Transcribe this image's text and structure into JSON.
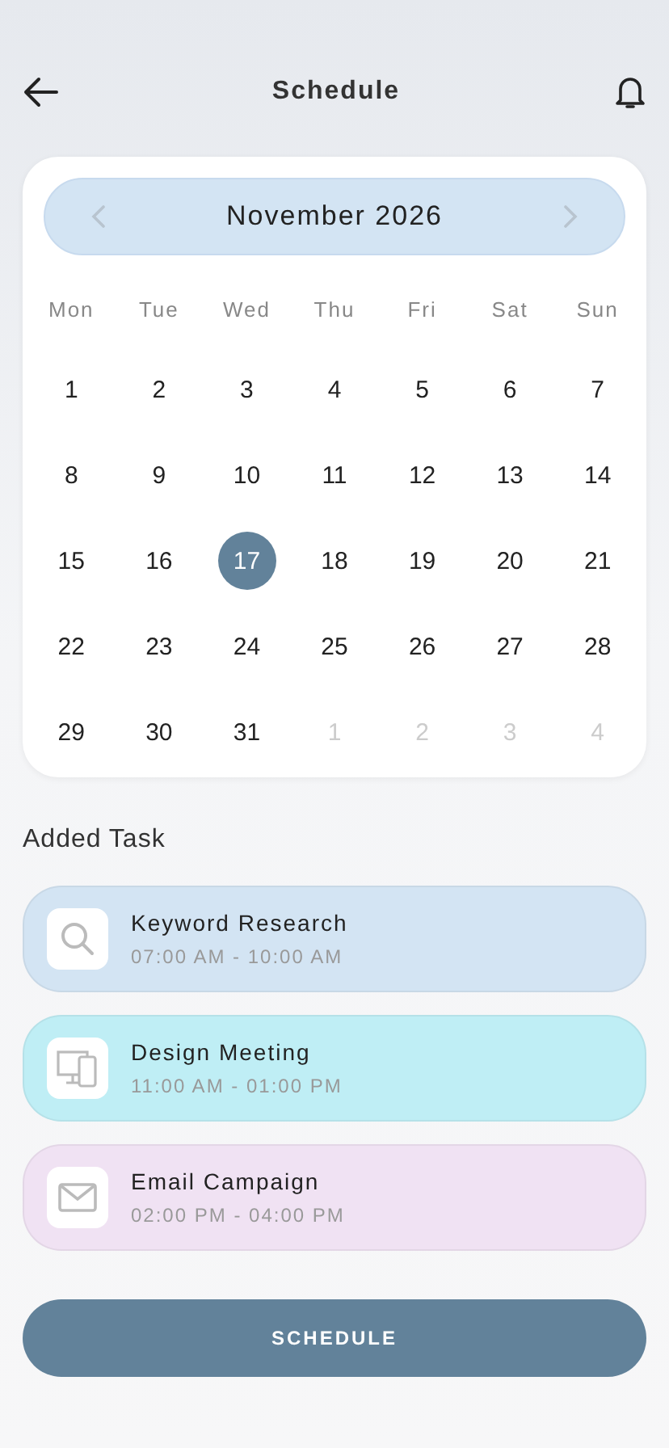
{
  "header": {
    "title": "Schedule"
  },
  "calendar": {
    "month": "November 2026",
    "weekdays": [
      "Mon",
      "Tue",
      "Wed",
      "Thu",
      "Fri",
      "Sat",
      "Sun"
    ],
    "days": [
      {
        "label": "1",
        "selected": false,
        "outside": false
      },
      {
        "label": "2",
        "selected": false,
        "outside": false
      },
      {
        "label": "3",
        "selected": false,
        "outside": false
      },
      {
        "label": "4",
        "selected": false,
        "outside": false
      },
      {
        "label": "5",
        "selected": false,
        "outside": false
      },
      {
        "label": "6",
        "selected": false,
        "outside": false
      },
      {
        "label": "7",
        "selected": false,
        "outside": false
      },
      {
        "label": "8",
        "selected": false,
        "outside": false
      },
      {
        "label": "9",
        "selected": false,
        "outside": false
      },
      {
        "label": "10",
        "selected": false,
        "outside": false
      },
      {
        "label": "11",
        "selected": false,
        "outside": false
      },
      {
        "label": "12",
        "selected": false,
        "outside": false
      },
      {
        "label": "13",
        "selected": false,
        "outside": false
      },
      {
        "label": "14",
        "selected": false,
        "outside": false
      },
      {
        "label": "15",
        "selected": false,
        "outside": false
      },
      {
        "label": "16",
        "selected": false,
        "outside": false
      },
      {
        "label": "17",
        "selected": true,
        "outside": false
      },
      {
        "label": "18",
        "selected": false,
        "outside": false
      },
      {
        "label": "19",
        "selected": false,
        "outside": false
      },
      {
        "label": "20",
        "selected": false,
        "outside": false
      },
      {
        "label": "21",
        "selected": false,
        "outside": false
      },
      {
        "label": "22",
        "selected": false,
        "outside": false
      },
      {
        "label": "23",
        "selected": false,
        "outside": false
      },
      {
        "label": "24",
        "selected": false,
        "outside": false
      },
      {
        "label": "25",
        "selected": false,
        "outside": false
      },
      {
        "label": "26",
        "selected": false,
        "outside": false
      },
      {
        "label": "27",
        "selected": false,
        "outside": false
      },
      {
        "label": "28",
        "selected": false,
        "outside": false
      },
      {
        "label": "29",
        "selected": false,
        "outside": false
      },
      {
        "label": "30",
        "selected": false,
        "outside": false
      },
      {
        "label": "31",
        "selected": false,
        "outside": false
      },
      {
        "label": "1",
        "selected": false,
        "outside": true
      },
      {
        "label": "2",
        "selected": false,
        "outside": true
      },
      {
        "label": "3",
        "selected": false,
        "outside": true
      },
      {
        "label": "4",
        "selected": false,
        "outside": true
      }
    ]
  },
  "tasks_heading": "Added Task",
  "tasks": [
    {
      "kind": "search",
      "title": "Keyword Research",
      "time": "07:00 AM - 10:00 AM",
      "color": "#d3e4f3"
    },
    {
      "kind": "devices",
      "title": "Design Meeting",
      "time": "11:00 AM - 01:00 PM",
      "color": "#bfeef5"
    },
    {
      "kind": "mail",
      "title": "Email Campaign",
      "time": "02:00 PM - 04:00 PM",
      "color": "#f0e2f3"
    }
  ],
  "button": "SCHEDULE"
}
